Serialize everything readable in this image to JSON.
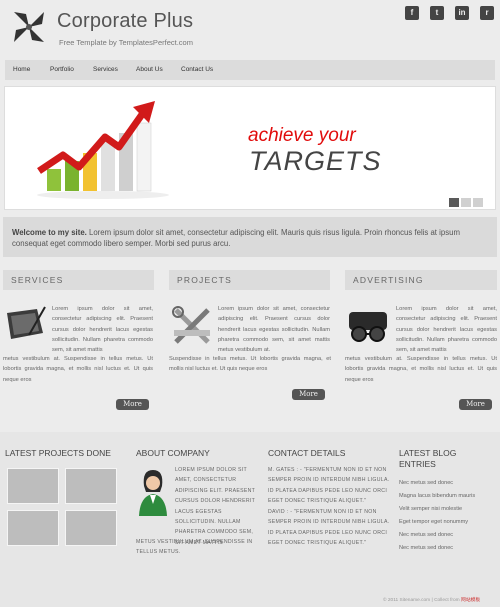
{
  "brand": {
    "title": "Corporate Plus",
    "subtitle": "Free Template by TemplatesPerfect.com"
  },
  "social": [
    {
      "icon": "facebook-icon",
      "glyph": "f"
    },
    {
      "icon": "twitter-icon",
      "glyph": "t"
    },
    {
      "icon": "linkedin-icon",
      "glyph": "in"
    },
    {
      "icon": "rss-icon",
      "glyph": "r"
    }
  ],
  "nav": [
    "Home",
    "Portfolio",
    "Services",
    "About Us",
    "Contact Us"
  ],
  "banner": {
    "line1": "achieve your",
    "line2": "TARGETS",
    "slides": 3,
    "active_slide": 1
  },
  "welcome": {
    "lead": "Welcome to my site.",
    "text": " Lorem ipsum dolor sit amet, consectetur adipiscing elit. Mauris quis risus ligula. Proin rhoncus felis at ipsum consequat eget commodo libero semper. Morbi sed purus arcu."
  },
  "columns": [
    {
      "heading": "SERVICES",
      "icon": "tablet-stylus-icon",
      "text": "Lorem ipsum dolor sit amet, consectetur adipiscing elit. Praesent cursus dolor hendrerit lacus egestas sollicitudin. Nullam pharetra commodo sem, sit amet mattis metus vestibulum at. Suspendisse in tellus metus. Ut lobortis gravida magna, et mollis nisl luctus et. Ut quis neque eros",
      "more": "More"
    },
    {
      "heading": "PROJECTS",
      "icon": "tools-icon",
      "text": "Lorem ipsum dolor sit amet, consectetur adipiscing elit. Praesent cursus dolor hendrerit lacus egestas sollicitudin. Nullam pharetra commodo sem, sit amet mattis metus vestibulum at. Suspendisse in tellus metus. Ut lobortis gravida magna, et mollis nisl luctus et. Ut quis neque eros",
      "more": "More"
    },
    {
      "heading": "ADVERTISING",
      "icon": "glasses-icon",
      "text": "Lorem ipsum dolor sit amet, consectetur adipiscing elit. Praesent cursus dolor hendrerit lacus egestas sollicitudin. Nullam pharetra commodo sem, sit amet mattis metus vestibulum at. Suspendisse in tellus metus. Ut lobortis gravida magna, et mollis nisl luctus et. Ut quis neque eros",
      "more": "More"
    }
  ],
  "footer": {
    "projects_heading": "LATEST PROJECTS DONE",
    "about_heading": "ABOUT COMPANY",
    "about_text": "Lorem ipsum dolor sit amet, consectetur adipiscing elit. Praesent cursus dolor hendrerit lacus egestas sollicitudin. Nullam pharetra commodo sem, sit amet mattis metus vestibulum at. Suspendisse in tellus metus.",
    "contact_heading": "CONTACT DETAILS",
    "contact_1": "M. GATES : - \"FERMENTUM NON ID ET NON SEMPER PROIN ID INTERDUM NIBH LIGULA. ID PLATEA DAPIBUS PEDE LEO NUNC ORCI EGET DONEC TRISTIQUE ALIQUET.\"",
    "contact_2": "DAVID : - \"FERMENTUM NON ID ET NON SEMPER PROIN ID INTERDUM NIBH LIGULA. ID PLATEA DAPIBUS PEDE LEO NUNC ORCI EGET DONEC TRISTIQUE ALIQUET.\"",
    "blog_heading_1": "LATEST BLOG",
    "blog_heading_2": "ENTRIES",
    "blog_entries": [
      "Nec metus sed donec",
      "Magna lacus bibendum mauris",
      "Velit semper nisi molestie",
      "Eget tempor eget nonummy",
      "Nec metus sed donec",
      "Nec metus sed donec"
    ],
    "copyright": "© 2011 Sitename.com | Collect from ",
    "copyright_link": "网站模板"
  },
  "colors": {
    "accent_red": "#e10c0c",
    "nav_bg": "#dcdcdc",
    "button_bg": "#555555"
  }
}
